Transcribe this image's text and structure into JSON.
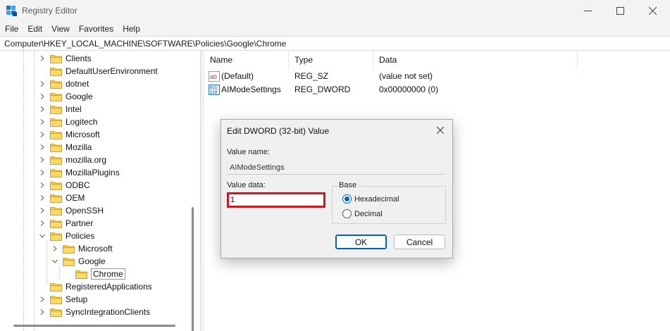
{
  "window": {
    "title": "Registry Editor",
    "minimize_icon": "minimize-icon",
    "maximize_icon": "maximize-icon",
    "close_icon": "close-icon"
  },
  "menu": [
    "File",
    "Edit",
    "View",
    "Favorites",
    "Help"
  ],
  "address": "Computer\\HKEY_LOCAL_MACHINE\\SOFTWARE\\Policies\\Google\\Chrome",
  "tree": [
    {
      "label": "Clients",
      "chevron": "right"
    },
    {
      "label": "DefaultUserEnvironment",
      "chevron": "none"
    },
    {
      "label": "dotnet",
      "chevron": "right"
    },
    {
      "label": "Google",
      "chevron": "right"
    },
    {
      "label": "Intel",
      "chevron": "right"
    },
    {
      "label": "Logitech",
      "chevron": "right"
    },
    {
      "label": "Microsoft",
      "chevron": "right"
    },
    {
      "label": "Mozilla",
      "chevron": "right"
    },
    {
      "label": "mozilla.org",
      "chevron": "right"
    },
    {
      "label": "MozillaPlugins",
      "chevron": "right"
    },
    {
      "label": "ODBC",
      "chevron": "right"
    },
    {
      "label": "OEM",
      "chevron": "right"
    },
    {
      "label": "OpenSSH",
      "chevron": "right"
    },
    {
      "label": "Partner",
      "chevron": "right"
    },
    {
      "label": "Policies",
      "chevron": "down"
    },
    {
      "label": "Microsoft",
      "chevron": "right"
    },
    {
      "label": "Google",
      "chevron": "down"
    },
    {
      "label": "Chrome",
      "chevron": "none",
      "selected": true
    },
    {
      "label": "RegisteredApplications",
      "chevron": "none"
    },
    {
      "label": "Setup",
      "chevron": "right"
    },
    {
      "label": "SyncIntegrationClients",
      "chevron": "right"
    }
  ],
  "list": {
    "columns": [
      "Name",
      "Type",
      "Data"
    ],
    "rows": [
      {
        "icon": "string-value-icon",
        "name": "(Default)",
        "type": "REG_SZ",
        "data": "(value not set)"
      },
      {
        "icon": "binary-value-icon",
        "name": "AIModeSettings",
        "type": "REG_DWORD",
        "data": "0x00000000 (0)"
      }
    ]
  },
  "dialog": {
    "title": "Edit DWORD (32-bit) Value",
    "value_name_label": "Value name:",
    "value_name": "AIModeSettings",
    "value_data_label": "Value data:",
    "value_data": "1",
    "base_label": "Base",
    "hex_label": "Hexadecimal",
    "dec_label": "Decimal",
    "base_selected": "Hexadecimal",
    "ok_label": "OK",
    "cancel_label": "Cancel",
    "highlight_color": "#d4141c"
  },
  "colors": {
    "folder": "#f5c542",
    "accent": "#0060c0"
  }
}
